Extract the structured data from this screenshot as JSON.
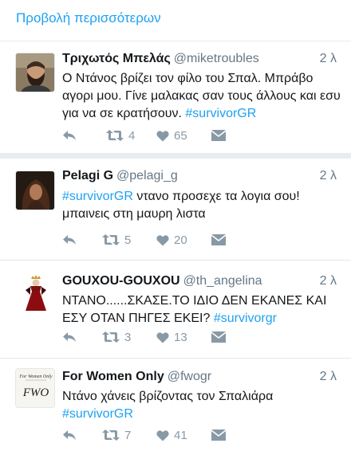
{
  "show_more": "Προβολή περισσότερων",
  "colors": {
    "link": "#1da1f2",
    "muted": "#657786",
    "icon": "#8899a6"
  },
  "tweets": [
    {
      "name": "Τριχωτός Μπελάς",
      "handle": "@miketroubles",
      "time": "2 λ",
      "text_before": "Ο Ντάνος βρίζει τον φίλο του Σπαλ. Μπράβο αγορι μου. Γίνε μαλακας σαν τους άλλους και εσυ για να σε κρατήσουν. ",
      "hashtag": "#survivorGR",
      "text_after": "",
      "retweets": "4",
      "likes": "65",
      "avatar_icon": "bearded-man-avatar"
    },
    {
      "name": "Pelagi G",
      "handle": "@pelagi_g",
      "time": "2 λ",
      "text_before": "",
      "hashtag": "#survivorGR",
      "text_after": " ντανο προσεχε τα λογια σου! μπαινεις στη μαυρη λιστα",
      "retweets": "5",
      "likes": "20",
      "avatar_icon": "woman-portrait-avatar"
    },
    {
      "name": "GOUXOU-GOUXOU",
      "handle": "@th_angelina",
      "time": "2 λ",
      "text_before": "ΝΤΑΝΟ......ΣΚΑΣΕ.ΤΟ ΙΔΙΟ ΔΕΝ ΕΚΑΝΕΣ ΚΑΙ ΕΣΥ ΟΤΑΝ ΠΗΓΕΣ ΕΚΕΙ? ",
      "hashtag": "#survivorgr",
      "text_after": "",
      "retweets": "3",
      "likes": "13",
      "avatar_icon": "queen-figure-avatar"
    },
    {
      "name": "For Women Only",
      "handle": "@fwogr",
      "time": "2 λ",
      "text_before": "Ντάνο χάνεις βρίζοντας τον Σπαλιάρα ",
      "hashtag": "#survivorGR",
      "text_after": "",
      "retweets": "7",
      "likes": "41",
      "avatar_icon": "fwo-logo-avatar",
      "avatar_logo_top": "For Women Only",
      "avatar_logo_main": "FWO"
    }
  ]
}
